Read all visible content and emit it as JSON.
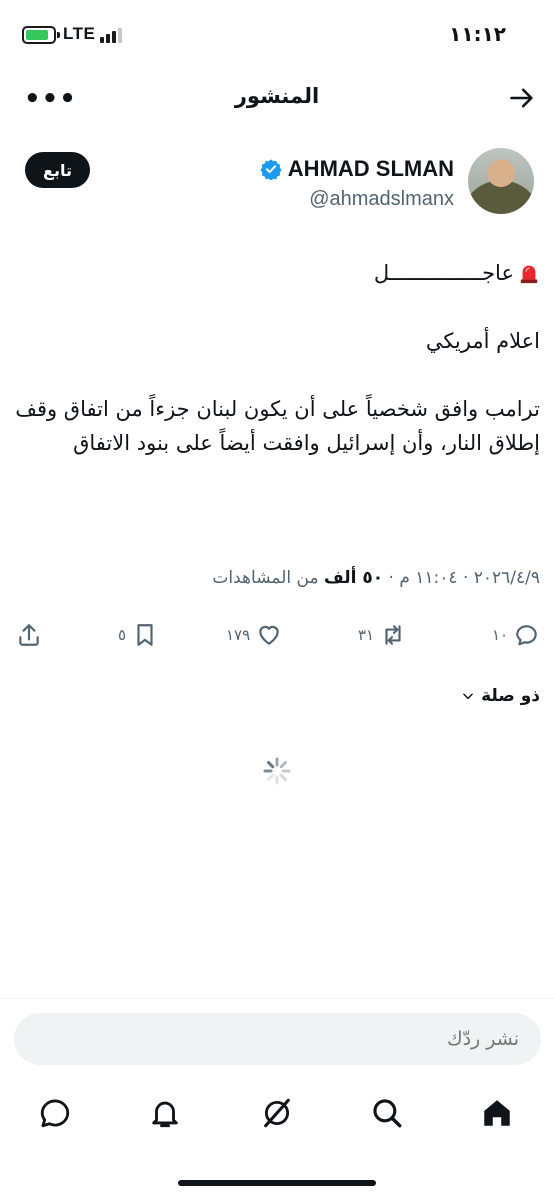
{
  "status_bar": {
    "time": "١١:١٢",
    "network": "LTE"
  },
  "header": {
    "title": "المنشور",
    "more_label": "•••"
  },
  "author": {
    "display_name": "AHMAD SLMAN",
    "handle": "@ahmadslmanx",
    "follow_label": "تابع"
  },
  "post": {
    "urgent": "عاجـــــــــــــــل",
    "line2": "اعلام أمريكي",
    "line3": "ترامب وافق شخصياً على أن يكون لبنان جزءاً من اتفاق وقف إطلاق النار، وأن إسرائيل وافقت أيضاً على بنود الاتفاق"
  },
  "meta": {
    "date": "٢٠٢٦/٤/٩",
    "time": "١١:٠٤ م",
    "views_count": "٥٠ ألف",
    "views_label": "من المشاهدات",
    "separator": "·"
  },
  "actions": {
    "replies": "١٠",
    "reposts": "٣١",
    "likes": "١٧٩",
    "bookmarks": "٥"
  },
  "related": {
    "label": "ذو صلة"
  },
  "reply": {
    "placeholder": "نشر ردّك"
  },
  "colors": {
    "text": "#0f1419",
    "muted": "#536471",
    "verified": "#1d9bf0",
    "battery": "#34c759"
  }
}
